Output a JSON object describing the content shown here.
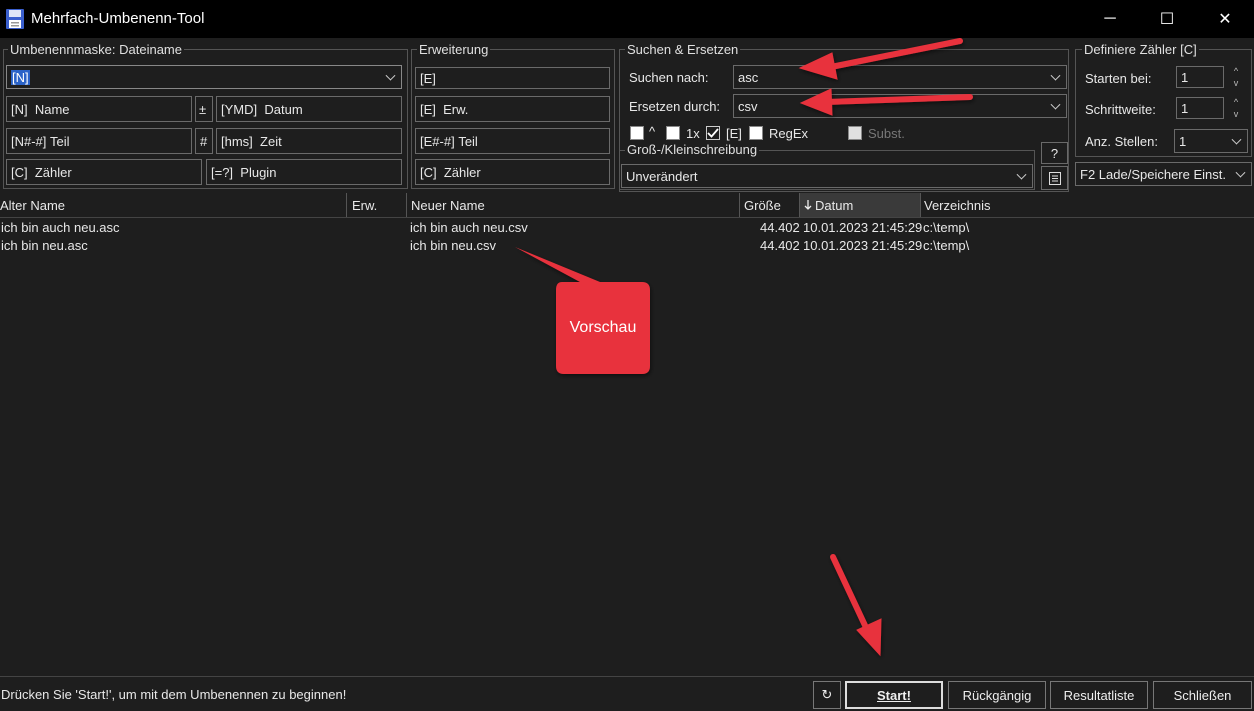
{
  "window": {
    "title": "Mehrfach-Umbenenn-Tool",
    "minimize": "─",
    "maximize": "☐",
    "close": "✕"
  },
  "mask": {
    "label": "Umbenennmaske: Dateiname",
    "value": "[N]",
    "buttons": {
      "name_code": "[N]",
      "name_label": "Name",
      "plus": "±",
      "date_code": "[YMD]",
      "date_label": "Datum",
      "part_code": "[N#-#]",
      "part_label": "Teil",
      "hash": "#",
      "time_code": "[hms]",
      "time_label": "Zeit",
      "counter_code": "[C]",
      "counter_label": "Zähler",
      "plugin_code": "[=?]",
      "plugin_label": "Plugin"
    }
  },
  "extension": {
    "label": "Erweiterung",
    "value": "[E]",
    "ext_code": "[E]",
    "ext_label": "Erw.",
    "part_code": "[E#-#]",
    "part_label": "Teil",
    "counter_code": "[C]",
    "counter_label": "Zähler"
  },
  "search_replace": {
    "label": "Suchen & Ersetzen",
    "search_label": "Suchen nach:",
    "search_value": "asc",
    "replace_label": "Ersetzen durch:",
    "replace_value": "csv",
    "opt_caret": "^",
    "opt_1x": "1x",
    "opt_e": "[E]",
    "opt_regex": "RegEx",
    "opt_subst": "Subst."
  },
  "case": {
    "label": "Groß-/Kleinschreibung",
    "value": "Unverändert",
    "help": "?"
  },
  "counter": {
    "label": "Definiere Zähler [C]",
    "start_label": "Starten bei:",
    "start_value": "1",
    "step_label": "Schrittweite:",
    "step_value": "1",
    "digits_label": "Anz. Stellen:",
    "digits_value": "1",
    "load_save": "F2 Lade/Speichere Einst."
  },
  "list": {
    "columns": {
      "old_name": "Alter Name",
      "ext": "Erw.",
      "new_name": "Neuer Name",
      "size": "Größe",
      "date": "Datum",
      "dir": "Verzeichnis"
    },
    "rows": [
      {
        "old": "ich bin auch neu.asc",
        "new": "ich bin auch neu.csv",
        "size": "44.402",
        "date": "10.01.2023 21:45:29",
        "dir": "c:\\temp\\"
      },
      {
        "old": "ich bin neu.asc",
        "new": "ich bin neu.csv",
        "size": "44.402",
        "date": "10.01.2023 21:45:29",
        "dir": "c:\\temp\\"
      }
    ]
  },
  "annotation": {
    "callout": "Vorschau",
    "color": "#e8323c"
  },
  "bottom": {
    "status": "Drücken Sie 'Start!', um mit dem Umbenennen zu beginnen!",
    "refresh": "↻",
    "start": "Start!",
    "undo": "Rückgängig",
    "results": "Resultatliste",
    "close": "Schließen"
  }
}
